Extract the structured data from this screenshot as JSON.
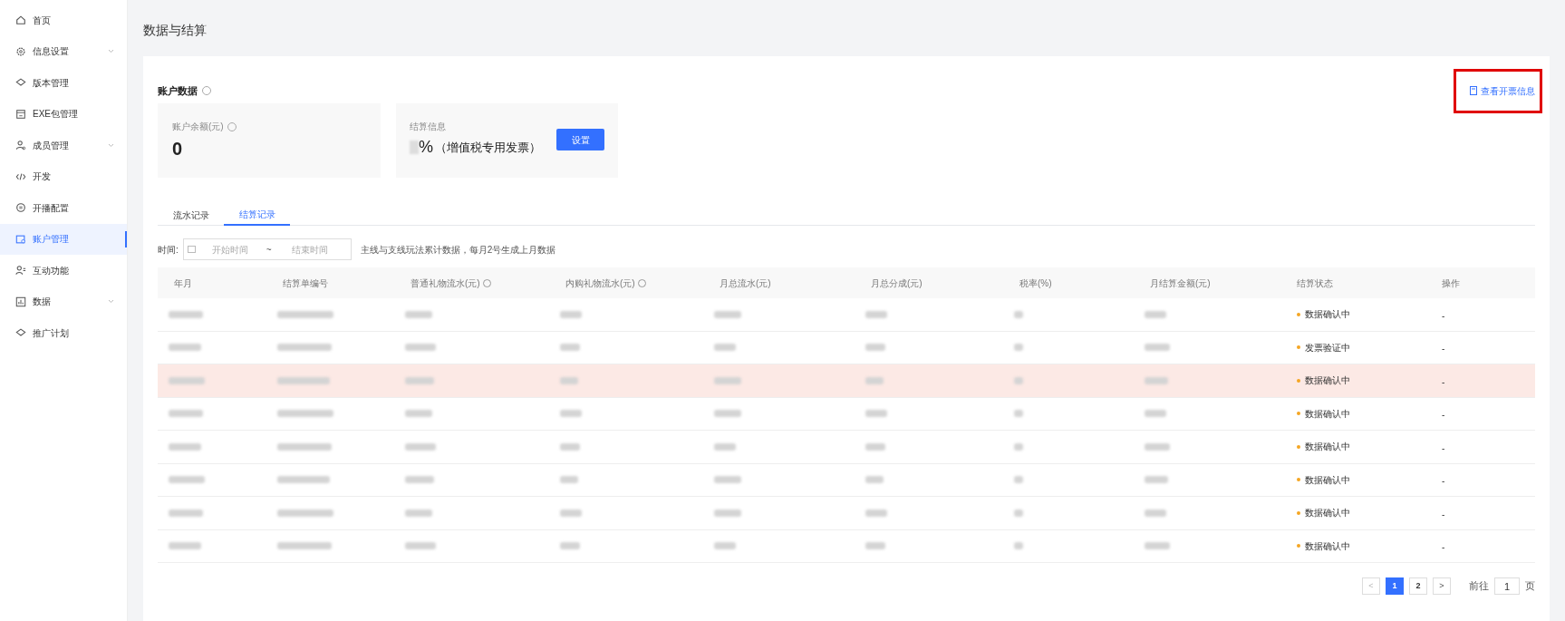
{
  "sidebar": {
    "items": [
      {
        "label": "首页",
        "expandable": false,
        "selected": false
      },
      {
        "label": "信息设置",
        "expandable": true,
        "selected": false
      },
      {
        "label": "版本管理",
        "expandable": false,
        "selected": false
      },
      {
        "label": "EXE包管理",
        "expandable": false,
        "selected": false
      },
      {
        "label": "成员管理",
        "expandable": true,
        "selected": false
      },
      {
        "label": "开发",
        "expandable": false,
        "selected": false
      },
      {
        "label": "开播配置",
        "expandable": false,
        "selected": false
      },
      {
        "label": "账户管理",
        "expandable": false,
        "selected": true
      },
      {
        "label": "互动功能",
        "expandable": false,
        "selected": false
      },
      {
        "label": "数据",
        "expandable": true,
        "selected": false
      },
      {
        "label": "推广计划",
        "expandable": false,
        "selected": false
      }
    ]
  },
  "page_title": "数据与结算",
  "account": {
    "title": "账户数据",
    "invoice_link": {
      "label": "查看开票信息",
      "annotated": true
    },
    "balance": {
      "label": "账户余额(元)",
      "value": "0"
    },
    "settlement": {
      "label": "结算信息",
      "value": "%",
      "note": "（增值税专用发票）",
      "button": "设置"
    }
  },
  "tabs": [
    {
      "label": "流水记录",
      "selected": false
    },
    {
      "label": "结算记录",
      "selected": true
    }
  ],
  "filter": {
    "label": "时间:",
    "start_placeholder": "开始时间",
    "separator": "~",
    "end_placeholder": "结束时间",
    "hint": "主线与支线玩法累计数据，每月2号生成上月数据"
  },
  "table": {
    "columns": [
      {
        "label": "年月",
        "help": false
      },
      {
        "label": "结算单编号",
        "help": false
      },
      {
        "label": "普通礼物流水(元)",
        "help": true
      },
      {
        "label": "内购礼物流水(元)",
        "help": true
      },
      {
        "label": "月总流水(元)",
        "help": false
      },
      {
        "label": "月总分成(元)",
        "help": false
      },
      {
        "label": "税率(%)",
        "help": false
      },
      {
        "label": "月结算金额(元)",
        "help": false
      },
      {
        "label": "结算状态",
        "help": false
      },
      {
        "label": "操作",
        "help": false
      }
    ],
    "rows": [
      {
        "status": "数据确认中",
        "action": "-",
        "selected": false
      },
      {
        "status": "发票验证中",
        "action": "-",
        "selected": false
      },
      {
        "status": "数据确认中",
        "action": "-",
        "selected": true
      },
      {
        "status": "数据确认中",
        "action": "-",
        "selected": false
      },
      {
        "status": "数据确认中",
        "action": "-",
        "selected": false
      },
      {
        "status": "数据确认中",
        "action": "-",
        "selected": false
      },
      {
        "status": "数据确认中",
        "action": "-",
        "selected": false
      },
      {
        "status": "数据确认中",
        "action": "-",
        "selected": false
      }
    ]
  },
  "pagination": {
    "prev": "<",
    "pages": [
      {
        "label": "1",
        "selected": true
      },
      {
        "label": "2",
        "selected": false
      }
    ],
    "next": ">",
    "goto_label": "前往",
    "goto_value": "1",
    "goto_suffix": "页"
  }
}
